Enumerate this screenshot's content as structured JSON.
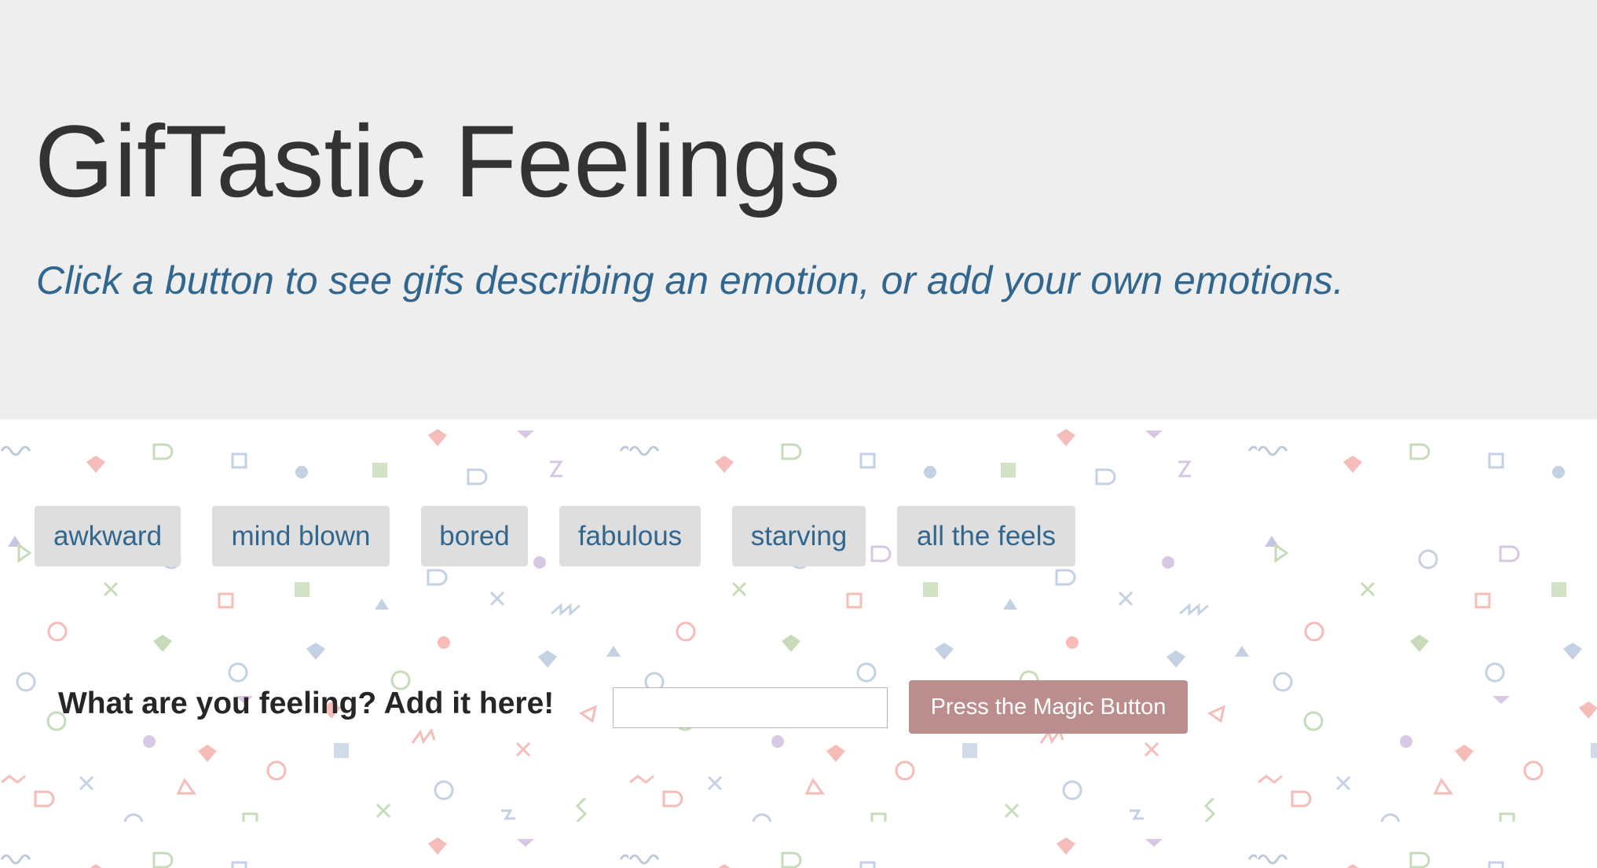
{
  "header": {
    "title": "GifTastic Feelings",
    "subtitle": "Click a button to see gifs describing an emotion, or add your own emotions."
  },
  "emotions": [
    {
      "label": "awkward"
    },
    {
      "label": "mind blown"
    },
    {
      "label": "bored"
    },
    {
      "label": "fabulous"
    },
    {
      "label": "starving"
    },
    {
      "label": "all the feels"
    }
  ],
  "form": {
    "label": "What are you feeling? Add it here!",
    "input_value": "",
    "submit_label": "Press the Magic Button"
  },
  "colors": {
    "jumbotron_bg": "#eeeeee",
    "subtitle": "#31668e",
    "emotion_button_bg": "#dedede",
    "magic_button_bg": "#bb8d8d"
  }
}
